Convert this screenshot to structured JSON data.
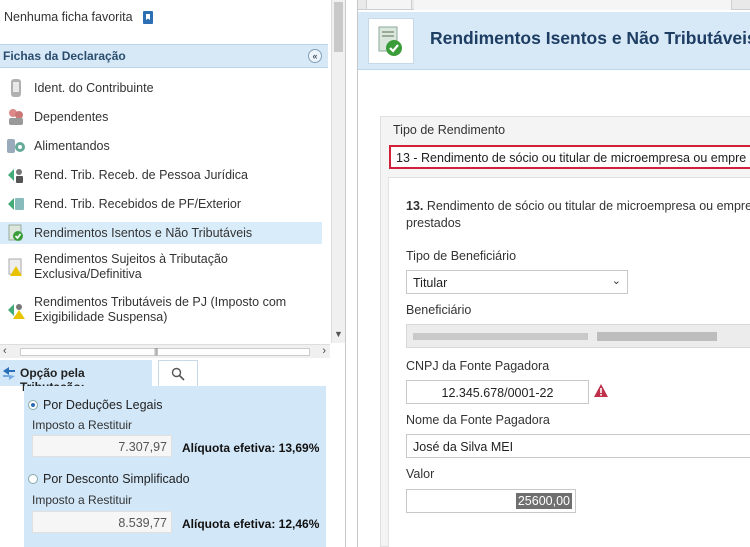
{
  "favorites": {
    "label": "Nenhuma ficha favorita",
    "icon": "bookmark-icon"
  },
  "fichas": {
    "title": "Fichas da Declaração",
    "items": [
      {
        "label": "Ident. do Contribuinte",
        "icon": "contribuinte-icon"
      },
      {
        "label": "Dependentes",
        "icon": "dependentes-icon"
      },
      {
        "label": "Alimentandos",
        "icon": "alimentandos-icon"
      },
      {
        "label": "Rend. Trib. Receb. de Pessoa Jurídica",
        "icon": "rend-pj-icon"
      },
      {
        "label": "Rend. Trib. Recebidos de PF/Exterior",
        "icon": "rend-pf-icon"
      },
      {
        "label": "Rendimentos Isentos e Não Tributáveis",
        "icon": "isentos-icon",
        "selected": true
      },
      {
        "label": "Rendimentos Sujeitos à Tributação Exclusiva/Definitiva",
        "icon": "exclusiva-icon"
      },
      {
        "label": "Rendimentos Tributáveis de PJ (Imposto com Exigibilidade Suspensa)",
        "icon": "suspensa-icon"
      }
    ]
  },
  "opcao": {
    "title": "Opção pela Tributação:",
    "deducoes": {
      "label": "Por Deduções Legais",
      "imposto_label": "Imposto a Restituir",
      "imposto_value": "7.307,97",
      "aliquota": "Alíquota efetiva: 13,69%",
      "selected": true
    },
    "simplificado": {
      "label": "Por Desconto Simplificado",
      "imposto_label": "Imposto a Restituir",
      "imposto_value": "8.539,77",
      "aliquota": "Alíquota efetiva: 12,46%",
      "selected": false
    }
  },
  "main": {
    "title": "Rendimentos Isentos e Não Tributáveis",
    "tipo_rendimento_label": "Tipo de Rendimento",
    "tipo_rendimento_value": "13 - Rendimento de sócio ou titular de microempresa ou empre",
    "desc_number": "13.",
    "desc_text": " Rendimento de sócio ou titular de microempresa ou empre prestados",
    "tipo_beneficiario_label": "Tipo de Beneficiário",
    "tipo_beneficiario_value": "Titular",
    "beneficiario_label": "Beneficiário",
    "cnpj_label": "CNPJ da Fonte Pagadora",
    "cnpj_value": "12.345.678/0001-22",
    "nome_label": "Nome da Fonte Pagadora",
    "nome_value": "José da Silva MEI",
    "valor_label": "Valor",
    "valor_value": "25600,00"
  },
  "colors": {
    "accent_panel": "#d7e9f7",
    "title_text": "#1d3d63",
    "error_border": "#d0203a"
  }
}
